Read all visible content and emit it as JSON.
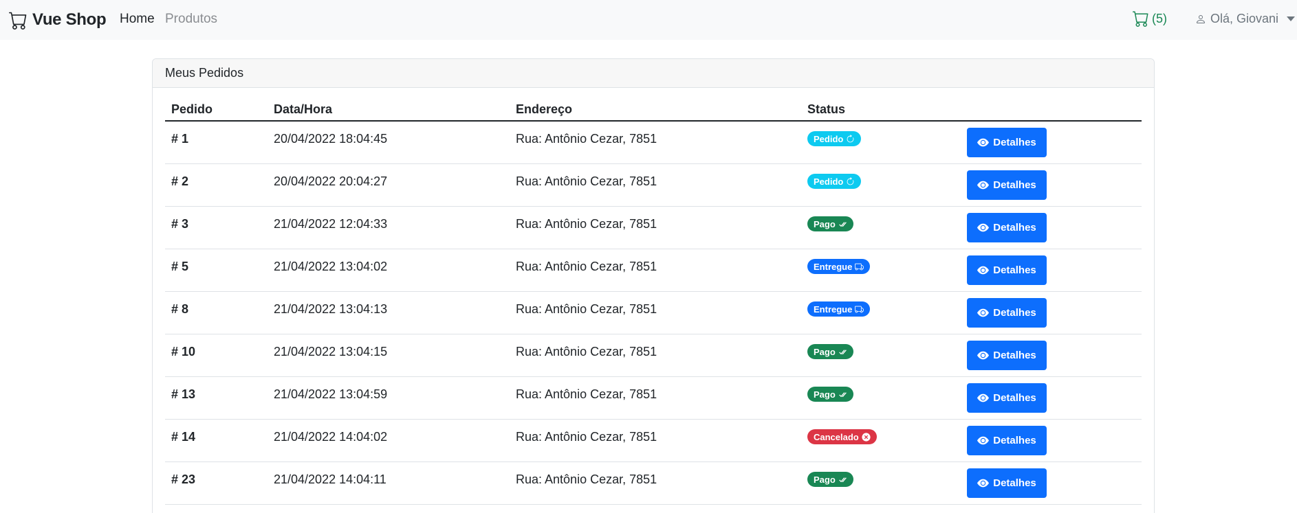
{
  "nav": {
    "brand": "Vue Shop",
    "home": "Home",
    "products": "Produtos",
    "cart_count": "(5)",
    "user_greeting": "Olá, Giovani"
  },
  "card": {
    "title": "Meus Pedidos"
  },
  "table": {
    "headers": {
      "order": "Pedido",
      "datetime": "Data/Hora",
      "address": "Endereço",
      "status": "Status"
    },
    "rows": [
      {
        "order": "# 1",
        "datetime": "20/04/2022 18:04:45",
        "address": "Rua: Antônio Cezar, 7851",
        "status": "Pedido",
        "status_icon": "refresh-icon",
        "status_color": "#0dcaf0",
        "action": "Detalhes"
      },
      {
        "order": "# 2",
        "datetime": "20/04/2022 20:04:27",
        "address": "Rua: Antônio Cezar, 7851",
        "status": "Pedido",
        "status_icon": "refresh-icon",
        "status_color": "#0dcaf0",
        "action": "Detalhes"
      },
      {
        "order": "# 3",
        "datetime": "21/04/2022 12:04:33",
        "address": "Rua: Antônio Cezar, 7851",
        "status": "Pago",
        "status_icon": "check-double-icon",
        "status_color": "#198754",
        "action": "Detalhes"
      },
      {
        "order": "# 5",
        "datetime": "21/04/2022 13:04:02",
        "address": "Rua: Antônio Cezar, 7851",
        "status": "Entregue",
        "status_icon": "truck-icon",
        "status_color": "#0d6efd",
        "action": "Detalhes"
      },
      {
        "order": "# 8",
        "datetime": "21/04/2022 13:04:13",
        "address": "Rua: Antônio Cezar, 7851",
        "status": "Entregue",
        "status_icon": "truck-icon",
        "status_color": "#0d6efd",
        "action": "Detalhes"
      },
      {
        "order": "# 10",
        "datetime": "21/04/2022 13:04:15",
        "address": "Rua: Antônio Cezar, 7851",
        "status": "Pago",
        "status_icon": "check-double-icon",
        "status_color": "#198754",
        "action": "Detalhes"
      },
      {
        "order": "# 13",
        "datetime": "21/04/2022 13:04:59",
        "address": "Rua: Antônio Cezar, 7851",
        "status": "Pago",
        "status_icon": "check-double-icon",
        "status_color": "#198754",
        "action": "Detalhes"
      },
      {
        "order": "# 14",
        "datetime": "21/04/2022 14:04:02",
        "address": "Rua: Antônio Cezar, 7851",
        "status": "Cancelado",
        "status_icon": "x-circle-icon",
        "status_color": "#dc3545",
        "action": "Detalhes"
      },
      {
        "order": "# 23",
        "datetime": "21/04/2022 14:04:11",
        "address": "Rua: Antônio Cezar, 7851",
        "status": "Pago",
        "status_icon": "check-double-icon",
        "status_color": "#198754",
        "action": "Detalhes"
      }
    ]
  },
  "colors": {
    "primary": "#0d6efd",
    "success": "#198754",
    "info": "#0dcaf0",
    "danger": "#dc3545",
    "navbar_bg": "#f8f9fa"
  }
}
